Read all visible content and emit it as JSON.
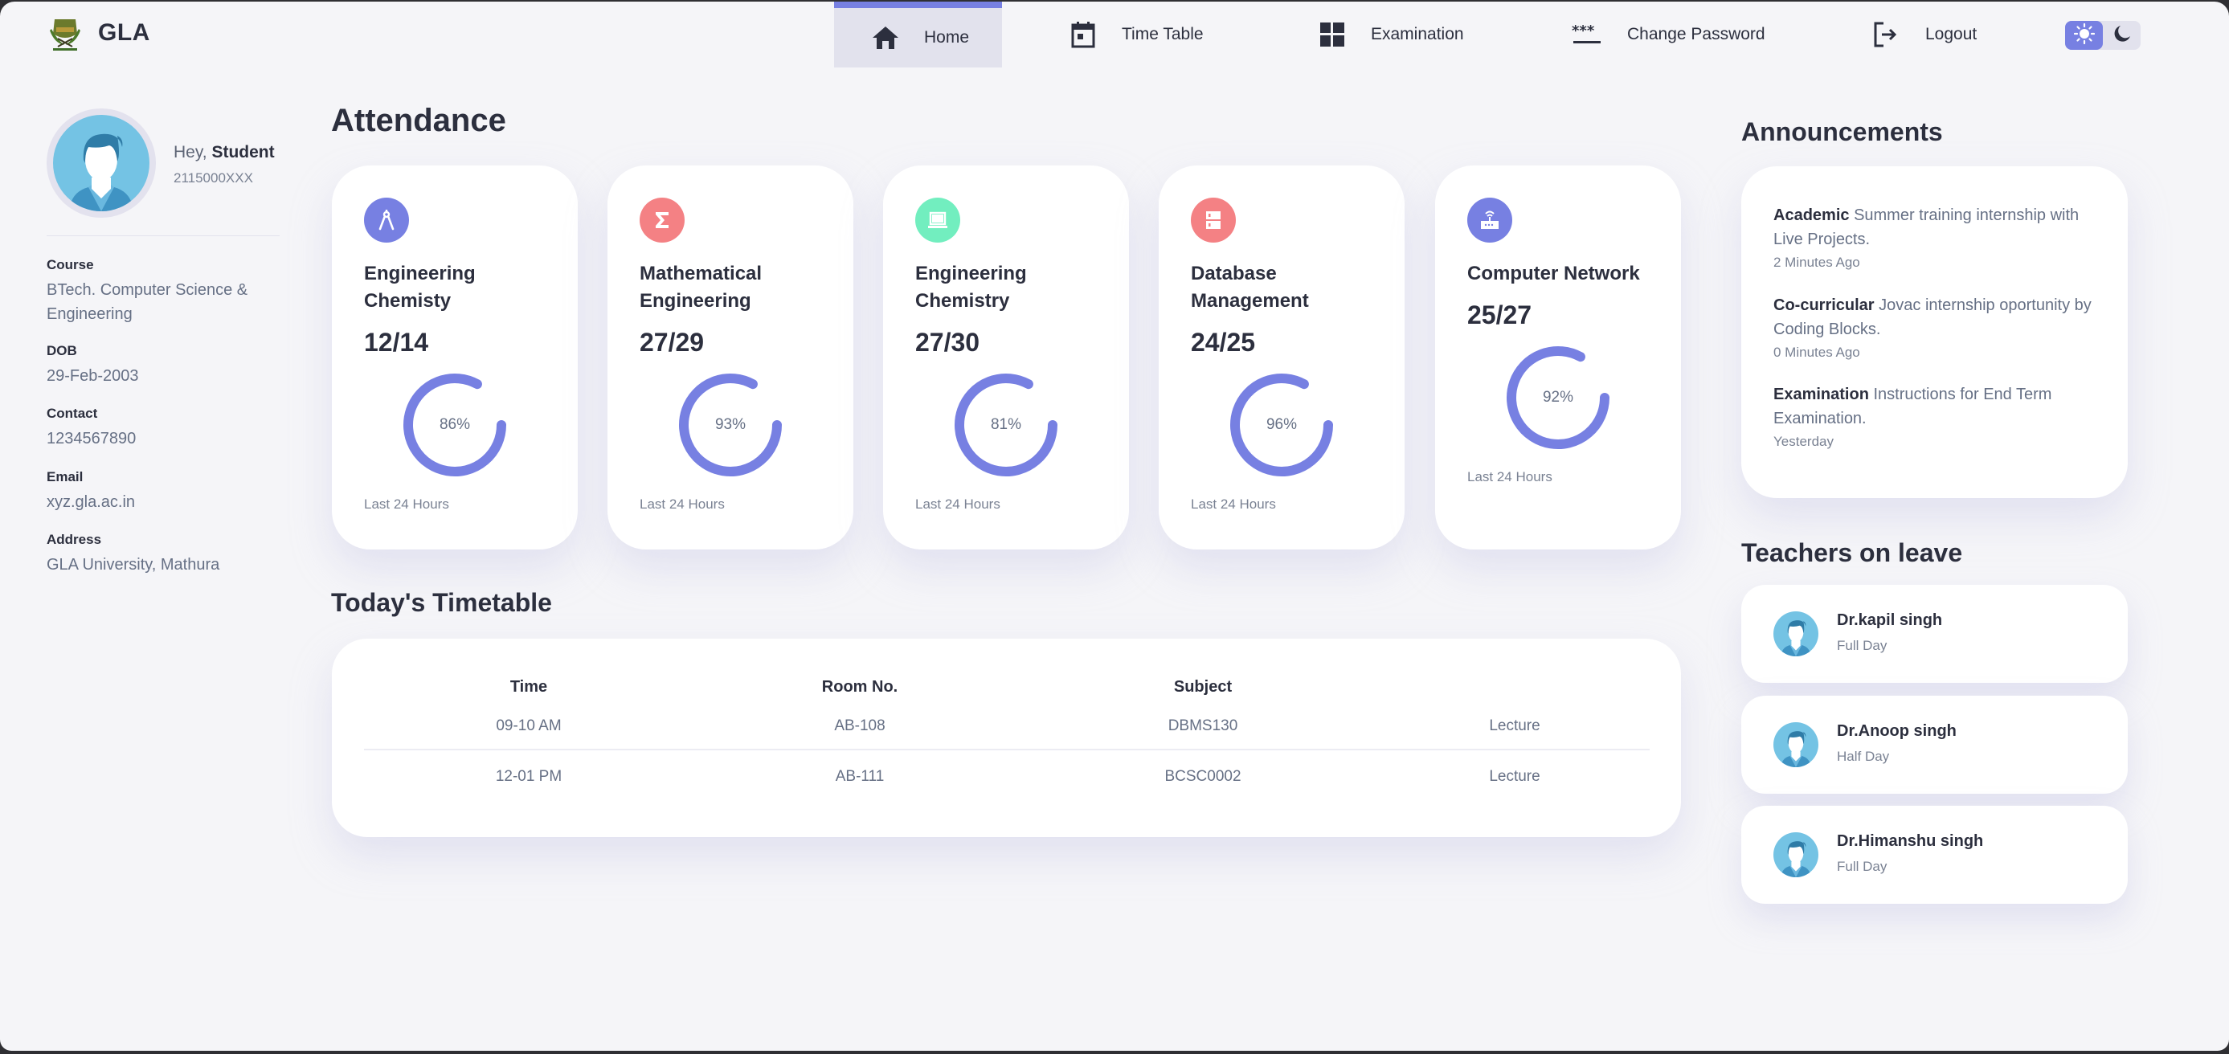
{
  "brand": {
    "name": "GLA",
    "logo": "gla-crest-logo"
  },
  "nav": {
    "items": [
      {
        "label": "Home",
        "icon": "home-icon",
        "active": true
      },
      {
        "label": "Time Table",
        "icon": "calendar-icon",
        "active": false
      },
      {
        "label": "Examination",
        "icon": "grid-icon",
        "active": false
      },
      {
        "label": "Change Password",
        "icon": "password-icon",
        "active": false
      },
      {
        "label": "Logout",
        "icon": "logout-icon",
        "active": false
      }
    ],
    "theme_toggle": {
      "options": [
        "light",
        "dark"
      ],
      "selected": "light"
    }
  },
  "profile": {
    "greeting": "Hey,",
    "name": "Student",
    "roll_no": "2115000XXX",
    "fields": [
      {
        "label": "Course",
        "value": "BTech. Computer Science & Engineering"
      },
      {
        "label": "DOB",
        "value": "29-Feb-2003"
      },
      {
        "label": "Contact",
        "value": "1234567890"
      },
      {
        "label": "Email",
        "value": "xyz.gla.ac.in"
      },
      {
        "label": "Address",
        "value": "GLA University, Mathura"
      }
    ]
  },
  "attendance": {
    "title": "Attendance",
    "cards": [
      {
        "subject": "Engineering Chemisty",
        "attended": "12/14",
        "percent": "86%",
        "ring_fill": 0.83,
        "period": "Last 24 Hours",
        "icon": "compass-icon",
        "color": "#7780e2"
      },
      {
        "subject": "Mathematical Engineering",
        "attended": "27/29",
        "percent": "93%",
        "ring_fill": 0.83,
        "period": "Last 24 Hours",
        "icon": "sigma-icon",
        "color": "#f48184"
      },
      {
        "subject": "Engineering Chemistry",
        "attended": "27/30",
        "percent": "81%",
        "ring_fill": 0.83,
        "period": "Last 24 Hours",
        "icon": "laptop-icon",
        "color": "#72eebf"
      },
      {
        "subject": "Database Management",
        "attended": "24/25",
        "percent": "96%",
        "ring_fill": 0.83,
        "period": "Last 24 Hours",
        "icon": "server-icon",
        "color": "#f48184"
      },
      {
        "subject": "Computer Network",
        "attended": "25/27",
        "percent": "92%",
        "ring_fill": 0.83,
        "period": "Last 24 Hours",
        "icon": "router-icon",
        "color": "#7780e2"
      }
    ],
    "ring_color": "#7780e2"
  },
  "timetable": {
    "title": "Today's Timetable",
    "columns": [
      "Time",
      "Room No.",
      "Subject",
      ""
    ],
    "rows": [
      [
        "09-10 AM",
        "AB-108",
        "DBMS130",
        "Lecture"
      ],
      [
        "12-01 PM",
        "AB-111",
        "BCSC0002",
        "Lecture"
      ]
    ]
  },
  "announcements": {
    "title": "Announcements",
    "items": [
      {
        "category": "Academic",
        "text": "Summer training internship with Live Projects.",
        "time": "2 Minutes Ago"
      },
      {
        "category": "Co-curricular",
        "text": "Jovac internship oportunity by Coding Blocks.",
        "time": "0 Minutes Ago"
      },
      {
        "category": "Examination",
        "text": "Instructions for End Term Examination.",
        "time": "Yesterday"
      }
    ]
  },
  "teachers_on_leave": {
    "title": "Teachers on leave",
    "items": [
      {
        "name": "Dr.kapil singh",
        "leave": "Full Day"
      },
      {
        "name": "Dr.Anoop singh",
        "leave": "Half Day"
      },
      {
        "name": "Dr.Himanshu singh",
        "leave": "Full Day"
      }
    ]
  }
}
